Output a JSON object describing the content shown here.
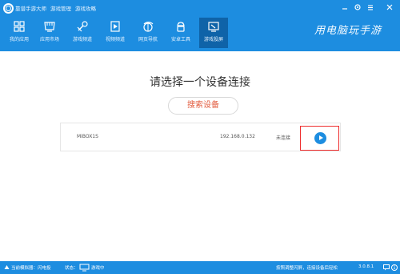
{
  "app": {
    "title": "靠谱手游大师",
    "menu1": "游戏管理",
    "menu2": "游戏攻略"
  },
  "window_controls": [
    "minimize-icon",
    "settings-icon",
    "menu-icon",
    "close-icon"
  ],
  "nav": [
    {
      "label": "我的应用",
      "icon": "apps-icon"
    },
    {
      "label": "应用市场",
      "icon": "market-icon"
    },
    {
      "label": "游戏频道",
      "icon": "game-icon"
    },
    {
      "label": "视频频道",
      "icon": "video-icon"
    },
    {
      "label": "网页导航",
      "icon": "browser-icon"
    },
    {
      "label": "安卓工具",
      "icon": "android-icon"
    },
    {
      "label": "游戏投屏",
      "icon": "cast-icon",
      "active": true
    }
  ],
  "slogan": "用电脑玩手游",
  "main": {
    "heading": "请选择一个设备连接",
    "search_button": "搜索设备",
    "device": {
      "name": "MiBOX1S",
      "ip": "192.168.0.132",
      "status": "未连接"
    }
  },
  "statusbar": {
    "left": "当前模拟器：闪电投",
    "mid_label": "状态：",
    "mid_value": "游戏中",
    "right": "按照调整闪屏，连接设备后轻松",
    "version": "3.0.8.1"
  },
  "colors": {
    "primary": "#1d8de0",
    "active_tab": "#0f63a8",
    "accent_red": "#e25a3c",
    "highlight_border": "#ee2d2d"
  }
}
